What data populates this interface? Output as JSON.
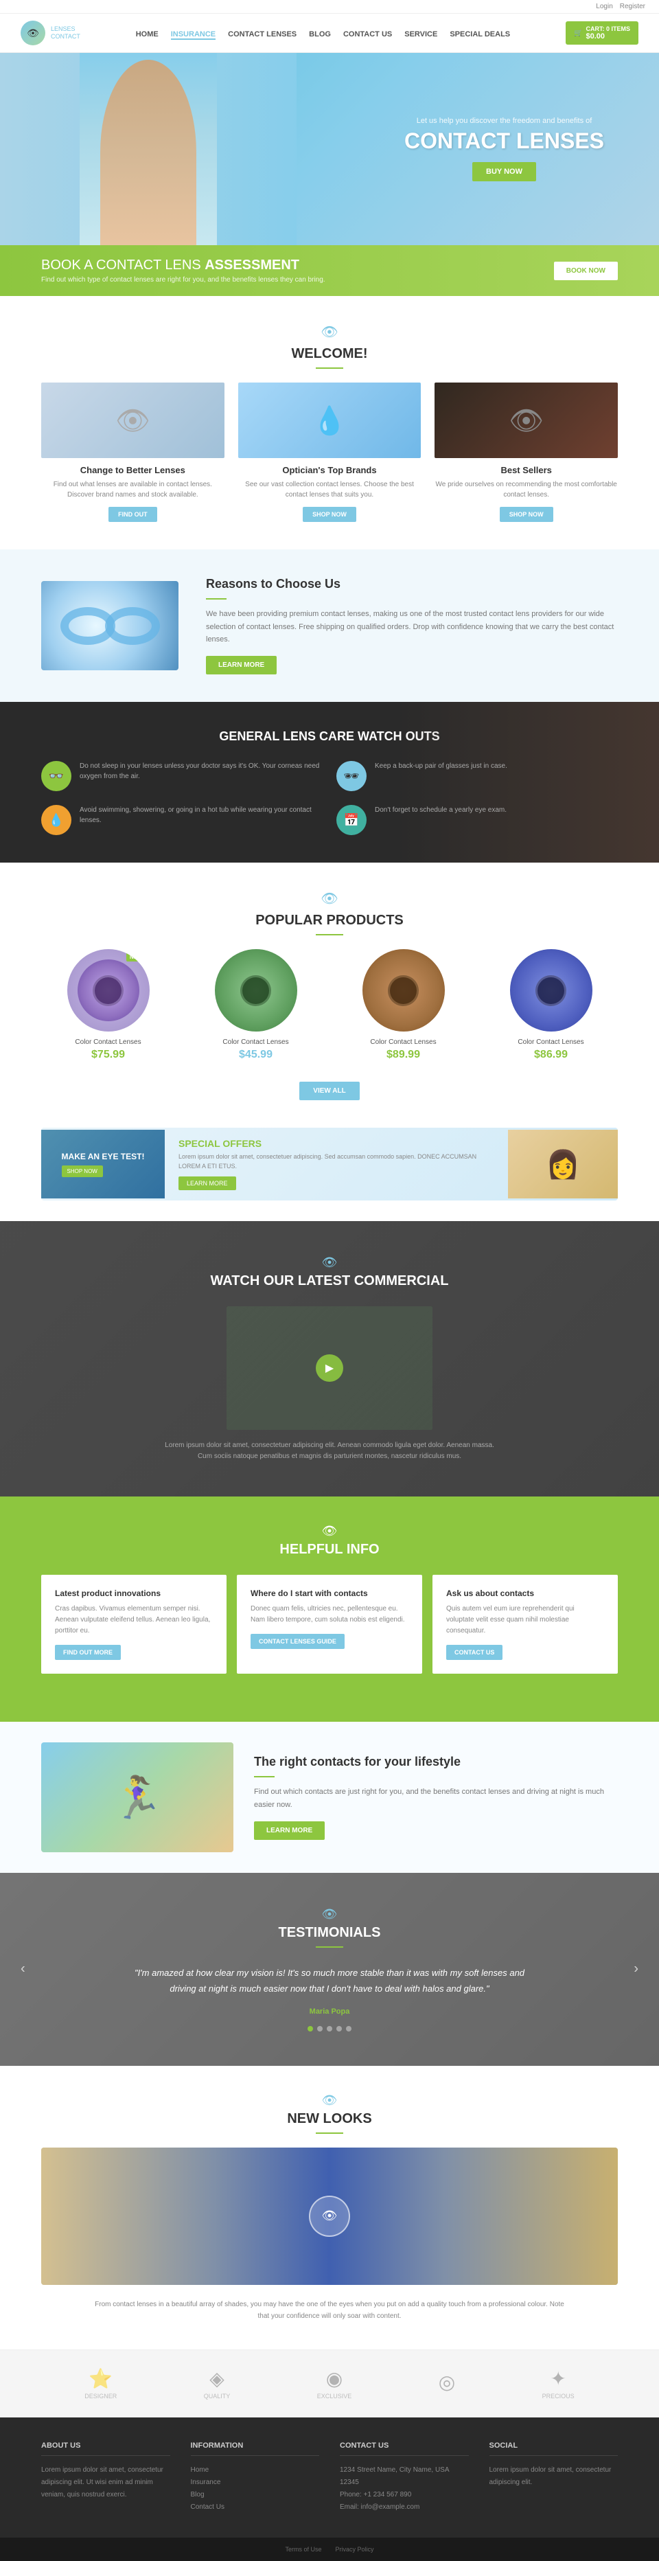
{
  "topbar": {
    "login": "Login",
    "register": "Register"
  },
  "navbar": {
    "logo_name": "CONTACT",
    "logo_sub": "LENSES",
    "links": [
      {
        "label": "HOME",
        "active": false
      },
      {
        "label": "INSURANCE",
        "active": true
      },
      {
        "label": "CONTACT LENSES",
        "active": false
      },
      {
        "label": "BLOG",
        "active": false
      },
      {
        "label": "CONTACT US",
        "active": false
      },
      {
        "label": "SERVICE",
        "active": false
      },
      {
        "label": "SPECIAL DEALS",
        "active": false
      }
    ],
    "cart_label": "CART: 0 ITEMS",
    "cart_value": "$0.00"
  },
  "hero": {
    "subtitle": "Let us help you discover the freedom and benefits of",
    "title": "CONTACT LENSES",
    "btn": "BUY NOW"
  },
  "assessment": {
    "prefix": "BOOK A CONTACT LENS ",
    "highlight": "ASSESSMENT",
    "description": "Find out which type of contact lenses are right for you, and the benefits lenses they can bring.",
    "btn": "BOOK NOW"
  },
  "welcome": {
    "icon": "👁",
    "title": "WELCOME!",
    "cards": [
      {
        "title": "Change to Better Lenses",
        "text": "Find out what lenses are available in contact lenses. Discover brand names and stock available.",
        "btn": "FIND OUT"
      },
      {
        "title": "Optician's Top Brands",
        "text": "See our vast collection contact lenses. Choose the best contact lenses that suits you.",
        "btn": "SHOP NOW"
      },
      {
        "title": "Best Sellers",
        "text": "We pride ourselves on recommending the most comfortable contact lenses.",
        "btn": "SHOP NOW"
      }
    ]
  },
  "reasons": {
    "title": "Reasons to Choose Us",
    "text": "We have been providing premium contact lenses, making us one of the most trusted contact lens providers for our wide selection of contact lenses. Free shipping on qualified orders. Drop with confidence knowing that we carry the best contact lenses.",
    "btn": "LEARN MORE"
  },
  "watchouts": {
    "title": "GENERAL LENS CARE WATCH OUTS",
    "items": [
      {
        "icon": "👓",
        "title": "Do not sleep in your lenses unless your doctor says it's OK. Your corneas need oxygen from the air.",
        "color": "green"
      },
      {
        "icon": "🕶",
        "title": "Keep a back-up pair of glasses just in case.",
        "color": "blue"
      },
      {
        "icon": "💧",
        "title": "Avoid swimming, showering, or going in a hot tub while wearing your contact lenses.",
        "color": "orange"
      },
      {
        "icon": "📅",
        "title": "Don't forget to schedule a yearly eye exam.",
        "color": "teal"
      }
    ]
  },
  "products": {
    "icon": "👁",
    "title": "POPULAR PRODUCTS",
    "items": [
      {
        "name": "Color Contact Lenses",
        "price": "$75.99",
        "color": "purple",
        "badge": true
      },
      {
        "name": "Color Contact Lenses",
        "price": "$45.99",
        "color": "green",
        "badge": false
      },
      {
        "name": "Color Contact Lenses",
        "price": "$89.99",
        "color": "brown",
        "badge": false
      },
      {
        "name": "Color Contact Lenses",
        "price": "$86.99",
        "color": "blue",
        "badge": false
      }
    ],
    "view_all_btn": "VIEW ALL"
  },
  "special_offers": {
    "left_title": "MAKE AN EYE TEST!",
    "left_sub": "SHOP NOW",
    "middle_title": "SPECIAL",
    "middle_highlight": " OFFERS",
    "middle_text": "Lorem ipsum dolor sit amet, consectetuer adipiscing. Sed accumsan commodo sapien. DONEC ACCUMSAN LOREM A ETI ETUS.",
    "btn": "LEARN MORE"
  },
  "video": {
    "icon": "👁",
    "title": "WATCH OUR LATEST COMMERCIAL",
    "caption": "Lorem ipsum dolor sit amet, consectetuer adipiscing elit. Aenean commodo ligula eget dolor. Aenean massa. Cum sociis natoque penatibus et magnis dis parturient montes, nascetur ridiculus mus."
  },
  "helpful": {
    "icon": "👁",
    "title": "HELPFUL INFO",
    "cards": [
      {
        "title": "Latest product innovations",
        "text": "Cras dapibus. Vivamus elementum semper nisi. Aenean vulputate eleifend tellus. Aenean leo ligula, porttitor eu.",
        "btn": "FIND OUT MORE"
      },
      {
        "title": "Where do I start with contacts",
        "text": "Donec quam felis, ultricies nec, pellentesque eu. Nam libero tempore, cum soluta nobis est eligendi.",
        "btn": "CONTACT LENSES GUIDE"
      },
      {
        "title": "Ask us about contacts",
        "text": "Quis autem vel eum iure reprehenderit qui voluptate velit esse quam nihil molestiae consequatur.",
        "btn": "CONTACT US"
      }
    ]
  },
  "lifestyle": {
    "title": "The right contacts for your lifestyle",
    "text": "Find out which contacts are just right for you, and the benefits contact lenses and driving at night is much easier now.",
    "btn": "LEARN MORE"
  },
  "testimonials": {
    "icon": "👁",
    "title": "TESTIMONIALS",
    "quote": "\"I'm amazed at how clear my vision is! It's so much more stable than it was with my soft lenses and driving at night is much easier now that I don't have to deal with halos and glare.\"",
    "author": "Maria Popa",
    "dots": [
      true,
      false,
      false,
      false,
      false
    ]
  },
  "new_looks": {
    "icon": "👁",
    "title": "NEW LOOKS",
    "caption": "From contact lenses in a beautiful array of shades, you may have the one of the eyes when you put on add a quality touch from a professional colour. Note that your confidence will only soar with content."
  },
  "badges": [
    {
      "icon": "★",
      "label": "DESIGNER"
    },
    {
      "icon": "◈",
      "label": "QUALITY"
    },
    {
      "icon": "◉",
      "label": "EXCLUSIVE"
    },
    {
      "icon": "◎",
      "label": ""
    },
    {
      "icon": "✦",
      "label": "PRECIOUS"
    }
  ],
  "footer": {
    "cols": [
      {
        "title": "ABOUT US",
        "text": "Lorem ipsum dolor sit amet, consectetur adipiscing elit. Ut wisi enim ad minim veniam, quis nostrud exerci."
      },
      {
        "title": "INFORMATION",
        "links": [
          "Home",
          "Insurance",
          "Blog",
          "Contact Us"
        ]
      },
      {
        "title": "CONTACT US",
        "text": "1234 Street Name, City Name, USA 12345\nPhone: +1 234 567 890\nEmail: info@example.com"
      },
      {
        "title": "SOCIAL",
        "text": "Lorem ipsum dolor sit amet, consectetur adipiscing elit."
      }
    ]
  },
  "footer_bottom": {
    "terms": "Terms of Use",
    "privacy": "Privacy Policy"
  }
}
